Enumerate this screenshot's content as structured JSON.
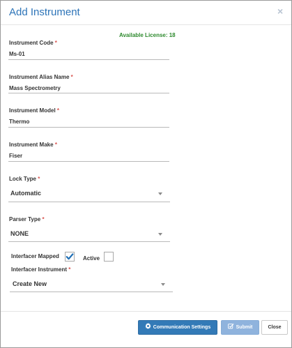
{
  "dialog": {
    "title": "Add Instrument",
    "close_glyph": "×",
    "license_text": "Available License: 18"
  },
  "fields": {
    "instrument_code": {
      "label": "Instrument Code",
      "value": "Ms-01"
    },
    "alias_name": {
      "label": "Instrument Alias Name",
      "value": "Mass Spectrometry"
    },
    "model": {
      "label": "Instrument Model",
      "value": "Thermo"
    },
    "make": {
      "label": "Instrument Make",
      "value": "Fiser"
    },
    "lock_type": {
      "label": "Lock Type",
      "value": "Automatic"
    },
    "parser_type": {
      "label": "Parser Type",
      "value": "NONE"
    },
    "interfacer_mapped": {
      "label": "Interfacer Mapped",
      "checked": true
    },
    "active": {
      "label": "Active",
      "checked": false
    },
    "interfacer_instrument": {
      "label": "Interfacer Instrument",
      "value": "Create New"
    }
  },
  "required_marker": "*",
  "footer": {
    "communication_settings": "Communication Settings",
    "submit": "Submit",
    "close": "Close"
  },
  "icons": {
    "gear": "gear-icon",
    "submit": "checkbox-edit-icon",
    "caret": "caret-down-icon",
    "check": "checkmark-icon"
  },
  "colors": {
    "title": "#2d74b8",
    "license": "#2e8a2e",
    "required": "#d9534f",
    "primary": "#337ab7",
    "primary_disabled": "#8fb3dd",
    "checkmark": "#1f6fb5"
  }
}
